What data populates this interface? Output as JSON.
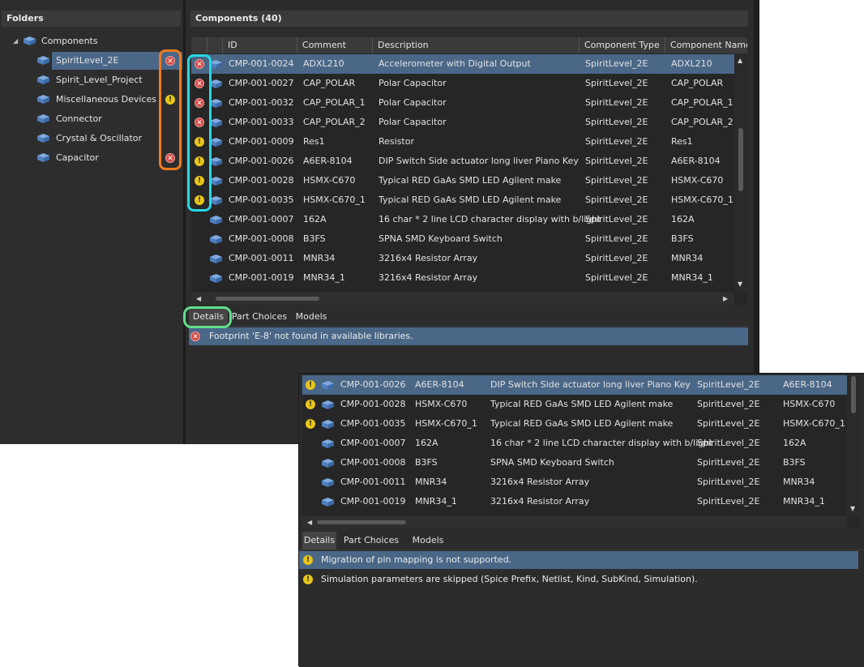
{
  "folders": {
    "title": "Folders",
    "root": "Components",
    "items": [
      {
        "label": "SpiritLevel_2E",
        "status": "error",
        "selected": true
      },
      {
        "label": "Spirit_Level_Project",
        "status": ""
      },
      {
        "label": "Miscellaneous Devices",
        "status": "warning"
      },
      {
        "label": "Connector",
        "status": ""
      },
      {
        "label": "Crystal & Oscillator",
        "status": ""
      },
      {
        "label": "Capacitor",
        "status": "error"
      }
    ]
  },
  "components": {
    "title": "Components (40)",
    "columns": [
      "ID",
      "Comment",
      "Description",
      "Component Type",
      "Component Name"
    ],
    "rows": [
      {
        "status": "error",
        "id": "CMP-001-0024",
        "comment": "ADXL210",
        "description": "Accelerometer with Digital Output",
        "type": "SpiritLevel_2E",
        "name": "ADXL210"
      },
      {
        "status": "error",
        "id": "CMP-001-0027",
        "comment": "CAP_POLAR",
        "description": "Polar Capacitor",
        "type": "SpiritLevel_2E",
        "name": "CAP_POLAR"
      },
      {
        "status": "error",
        "id": "CMP-001-0032",
        "comment": "CAP_POLAR_1",
        "description": "Polar Capacitor",
        "type": "SpiritLevel_2E",
        "name": "CAP_POLAR_1"
      },
      {
        "status": "error",
        "id": "CMP-001-0033",
        "comment": "CAP_POLAR_2",
        "description": "Polar Capacitor",
        "type": "SpiritLevel_2E",
        "name": "CAP_POLAR_2"
      },
      {
        "status": "warning",
        "id": "CMP-001-0009",
        "comment": "Res1",
        "description": "Resistor",
        "type": "SpiritLevel_2E",
        "name": "Res1"
      },
      {
        "status": "warning",
        "id": "CMP-001-0026",
        "comment": "A6ER-8104",
        "description": "DIP Switch Side actuator long liver Piano Key",
        "type": "SpiritLevel_2E",
        "name": "A6ER-8104"
      },
      {
        "status": "warning",
        "id": "CMP-001-0028",
        "comment": "HSMX-C670",
        "description": "Typical RED GaAs SMD LED Agilent make",
        "type": "SpiritLevel_2E",
        "name": "HSMX-C670"
      },
      {
        "status": "warning",
        "id": "CMP-001-0035",
        "comment": "HSMX-C670_1",
        "description": "Typical RED GaAs SMD LED Agilent make",
        "type": "SpiritLevel_2E",
        "name": "HSMX-C670_1"
      },
      {
        "status": "",
        "id": "CMP-001-0007",
        "comment": "162A",
        "description": "16 char * 2 line LCD character display with b/light",
        "type": "SpiritLevel_2E",
        "name": "162A"
      },
      {
        "status": "",
        "id": "CMP-001-0008",
        "comment": "B3FS",
        "description": "SPNA SMD Keyboard Switch",
        "type": "SpiritLevel_2E",
        "name": "B3FS"
      },
      {
        "status": "",
        "id": "CMP-001-0011",
        "comment": "MNR34",
        "description": "3216x4 Resistor Array",
        "type": "SpiritLevel_2E",
        "name": "MNR34"
      },
      {
        "status": "",
        "id": "CMP-001-0019",
        "comment": "MNR34_1",
        "description": "3216x4 Resistor Array",
        "type": "SpiritLevel_2E",
        "name": "MNR34_1"
      }
    ]
  },
  "details_tabs": [
    "Details",
    "Part Choices",
    "Models"
  ],
  "details_messages": [
    {
      "status": "error",
      "text": "Footprint 'E-8' not found in available libraries."
    }
  ],
  "inset": {
    "rows": [
      {
        "status": "warning",
        "id": "CMP-001-0026",
        "comment": "A6ER-8104",
        "description": "DIP Switch Side actuator long liver Piano Key",
        "type": "SpiritLevel_2E",
        "name": "A6ER-8104"
      },
      {
        "status": "warning",
        "id": "CMP-001-0028",
        "comment": "HSMX-C670",
        "description": "Typical RED GaAs SMD LED Agilent make",
        "type": "SpiritLevel_2E",
        "name": "HSMX-C670"
      },
      {
        "status": "warning",
        "id": "CMP-001-0035",
        "comment": "HSMX-C670_1",
        "description": "Typical RED GaAs SMD LED Agilent make",
        "type": "SpiritLevel_2E",
        "name": "HSMX-C670_1"
      },
      {
        "status": "",
        "id": "CMP-001-0007",
        "comment": "162A",
        "description": "16 char * 2 line LCD character display with b/light",
        "type": "SpiritLevel_2E",
        "name": "162A"
      },
      {
        "status": "",
        "id": "CMP-001-0008",
        "comment": "B3FS",
        "description": "SPNA SMD Keyboard Switch",
        "type": "SpiritLevel_2E",
        "name": "B3FS"
      },
      {
        "status": "",
        "id": "CMP-001-0011",
        "comment": "MNR34",
        "description": "3216x4 Resistor Array",
        "type": "SpiritLevel_2E",
        "name": "MNR34"
      },
      {
        "status": "",
        "id": "CMP-001-0019",
        "comment": "MNR34_1",
        "description": "3216x4 Resistor Array",
        "type": "SpiritLevel_2E",
        "name": "MNR34_1"
      }
    ],
    "tabs": [
      "Details",
      "Part Choices",
      "Models"
    ],
    "messages": [
      {
        "status": "warning",
        "text": "Migration of pin mapping is not supported."
      },
      {
        "status": "warning",
        "text": "Simulation parameters are skipped (Spice Prefix, Netlist, Kind, SubKind, Simulation)."
      }
    ]
  },
  "icons": {
    "component": "component-cube-icon",
    "error": "error-icon",
    "warning": "warning-icon",
    "expand": "expand-arrow-icon"
  },
  "colors": {
    "selection": "#4a6787",
    "error": "#d44a45",
    "warning": "#e9c618",
    "highlight_orange": "#f07b1e",
    "highlight_cyan": "#25d8e6",
    "highlight_green": "#5fe08c"
  }
}
